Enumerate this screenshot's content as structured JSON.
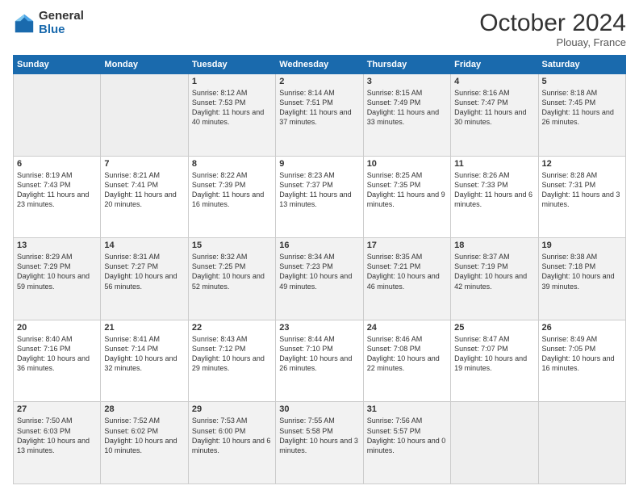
{
  "header": {
    "logo_general": "General",
    "logo_blue": "Blue",
    "month_title": "October 2024",
    "location": "Plouay, France"
  },
  "weekdays": [
    "Sunday",
    "Monday",
    "Tuesday",
    "Wednesday",
    "Thursday",
    "Friday",
    "Saturday"
  ],
  "rows": [
    [
      {
        "day": "",
        "sunrise": "",
        "sunset": "",
        "daylight": ""
      },
      {
        "day": "",
        "sunrise": "",
        "sunset": "",
        "daylight": ""
      },
      {
        "day": "1",
        "sunrise": "Sunrise: 8:12 AM",
        "sunset": "Sunset: 7:53 PM",
        "daylight": "Daylight: 11 hours and 40 minutes."
      },
      {
        "day": "2",
        "sunrise": "Sunrise: 8:14 AM",
        "sunset": "Sunset: 7:51 PM",
        "daylight": "Daylight: 11 hours and 37 minutes."
      },
      {
        "day": "3",
        "sunrise": "Sunrise: 8:15 AM",
        "sunset": "Sunset: 7:49 PM",
        "daylight": "Daylight: 11 hours and 33 minutes."
      },
      {
        "day": "4",
        "sunrise": "Sunrise: 8:16 AM",
        "sunset": "Sunset: 7:47 PM",
        "daylight": "Daylight: 11 hours and 30 minutes."
      },
      {
        "day": "5",
        "sunrise": "Sunrise: 8:18 AM",
        "sunset": "Sunset: 7:45 PM",
        "daylight": "Daylight: 11 hours and 26 minutes."
      }
    ],
    [
      {
        "day": "6",
        "sunrise": "Sunrise: 8:19 AM",
        "sunset": "Sunset: 7:43 PM",
        "daylight": "Daylight: 11 hours and 23 minutes."
      },
      {
        "day": "7",
        "sunrise": "Sunrise: 8:21 AM",
        "sunset": "Sunset: 7:41 PM",
        "daylight": "Daylight: 11 hours and 20 minutes."
      },
      {
        "day": "8",
        "sunrise": "Sunrise: 8:22 AM",
        "sunset": "Sunset: 7:39 PM",
        "daylight": "Daylight: 11 hours and 16 minutes."
      },
      {
        "day": "9",
        "sunrise": "Sunrise: 8:23 AM",
        "sunset": "Sunset: 7:37 PM",
        "daylight": "Daylight: 11 hours and 13 minutes."
      },
      {
        "day": "10",
        "sunrise": "Sunrise: 8:25 AM",
        "sunset": "Sunset: 7:35 PM",
        "daylight": "Daylight: 11 hours and 9 minutes."
      },
      {
        "day": "11",
        "sunrise": "Sunrise: 8:26 AM",
        "sunset": "Sunset: 7:33 PM",
        "daylight": "Daylight: 11 hours and 6 minutes."
      },
      {
        "day": "12",
        "sunrise": "Sunrise: 8:28 AM",
        "sunset": "Sunset: 7:31 PM",
        "daylight": "Daylight: 11 hours and 3 minutes."
      }
    ],
    [
      {
        "day": "13",
        "sunrise": "Sunrise: 8:29 AM",
        "sunset": "Sunset: 7:29 PM",
        "daylight": "Daylight: 10 hours and 59 minutes."
      },
      {
        "day": "14",
        "sunrise": "Sunrise: 8:31 AM",
        "sunset": "Sunset: 7:27 PM",
        "daylight": "Daylight: 10 hours and 56 minutes."
      },
      {
        "day": "15",
        "sunrise": "Sunrise: 8:32 AM",
        "sunset": "Sunset: 7:25 PM",
        "daylight": "Daylight: 10 hours and 52 minutes."
      },
      {
        "day": "16",
        "sunrise": "Sunrise: 8:34 AM",
        "sunset": "Sunset: 7:23 PM",
        "daylight": "Daylight: 10 hours and 49 minutes."
      },
      {
        "day": "17",
        "sunrise": "Sunrise: 8:35 AM",
        "sunset": "Sunset: 7:21 PM",
        "daylight": "Daylight: 10 hours and 46 minutes."
      },
      {
        "day": "18",
        "sunrise": "Sunrise: 8:37 AM",
        "sunset": "Sunset: 7:19 PM",
        "daylight": "Daylight: 10 hours and 42 minutes."
      },
      {
        "day": "19",
        "sunrise": "Sunrise: 8:38 AM",
        "sunset": "Sunset: 7:18 PM",
        "daylight": "Daylight: 10 hours and 39 minutes."
      }
    ],
    [
      {
        "day": "20",
        "sunrise": "Sunrise: 8:40 AM",
        "sunset": "Sunset: 7:16 PM",
        "daylight": "Daylight: 10 hours and 36 minutes."
      },
      {
        "day": "21",
        "sunrise": "Sunrise: 8:41 AM",
        "sunset": "Sunset: 7:14 PM",
        "daylight": "Daylight: 10 hours and 32 minutes."
      },
      {
        "day": "22",
        "sunrise": "Sunrise: 8:43 AM",
        "sunset": "Sunset: 7:12 PM",
        "daylight": "Daylight: 10 hours and 29 minutes."
      },
      {
        "day": "23",
        "sunrise": "Sunrise: 8:44 AM",
        "sunset": "Sunset: 7:10 PM",
        "daylight": "Daylight: 10 hours and 26 minutes."
      },
      {
        "day": "24",
        "sunrise": "Sunrise: 8:46 AM",
        "sunset": "Sunset: 7:08 PM",
        "daylight": "Daylight: 10 hours and 22 minutes."
      },
      {
        "day": "25",
        "sunrise": "Sunrise: 8:47 AM",
        "sunset": "Sunset: 7:07 PM",
        "daylight": "Daylight: 10 hours and 19 minutes."
      },
      {
        "day": "26",
        "sunrise": "Sunrise: 8:49 AM",
        "sunset": "Sunset: 7:05 PM",
        "daylight": "Daylight: 10 hours and 16 minutes."
      }
    ],
    [
      {
        "day": "27",
        "sunrise": "Sunrise: 7:50 AM",
        "sunset": "Sunset: 6:03 PM",
        "daylight": "Daylight: 10 hours and 13 minutes."
      },
      {
        "day": "28",
        "sunrise": "Sunrise: 7:52 AM",
        "sunset": "Sunset: 6:02 PM",
        "daylight": "Daylight: 10 hours and 10 minutes."
      },
      {
        "day": "29",
        "sunrise": "Sunrise: 7:53 AM",
        "sunset": "Sunset: 6:00 PM",
        "daylight": "Daylight: 10 hours and 6 minutes."
      },
      {
        "day": "30",
        "sunrise": "Sunrise: 7:55 AM",
        "sunset": "Sunset: 5:58 PM",
        "daylight": "Daylight: 10 hours and 3 minutes."
      },
      {
        "day": "31",
        "sunrise": "Sunrise: 7:56 AM",
        "sunset": "Sunset: 5:57 PM",
        "daylight": "Daylight: 10 hours and 0 minutes."
      },
      {
        "day": "",
        "sunrise": "",
        "sunset": "",
        "daylight": ""
      },
      {
        "day": "",
        "sunrise": "",
        "sunset": "",
        "daylight": ""
      }
    ]
  ]
}
